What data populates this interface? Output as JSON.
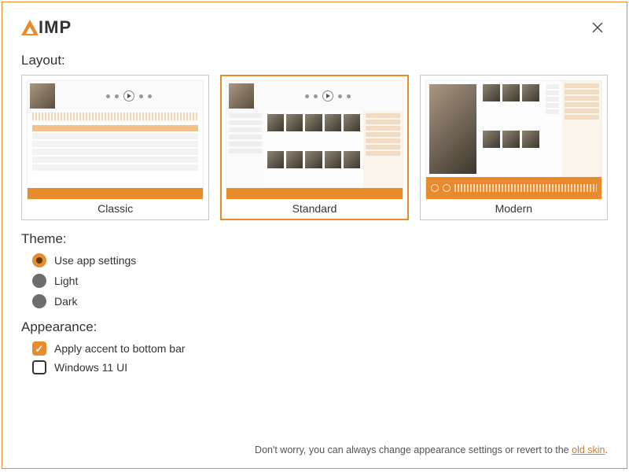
{
  "app": {
    "name": "IMP"
  },
  "sections": {
    "layout_label": "Layout:",
    "theme_label": "Theme:",
    "appearance_label": "Appearance:"
  },
  "layouts": [
    {
      "label": "Classic",
      "selected": false
    },
    {
      "label": "Standard",
      "selected": true
    },
    {
      "label": "Modern",
      "selected": false
    }
  ],
  "theme": {
    "options": [
      {
        "label": "Use app settings",
        "selected": true
      },
      {
        "label": "Light",
        "selected": false
      },
      {
        "label": "Dark",
        "selected": false
      }
    ]
  },
  "appearance": {
    "options": [
      {
        "label": "Apply accent to bottom bar",
        "checked": true
      },
      {
        "label": "Windows 11 UI",
        "checked": false
      }
    ]
  },
  "footer": {
    "text_before": "Don't worry, you can always change appearance settings or revert to the ",
    "link_text": "old skin",
    "text_after": "."
  }
}
